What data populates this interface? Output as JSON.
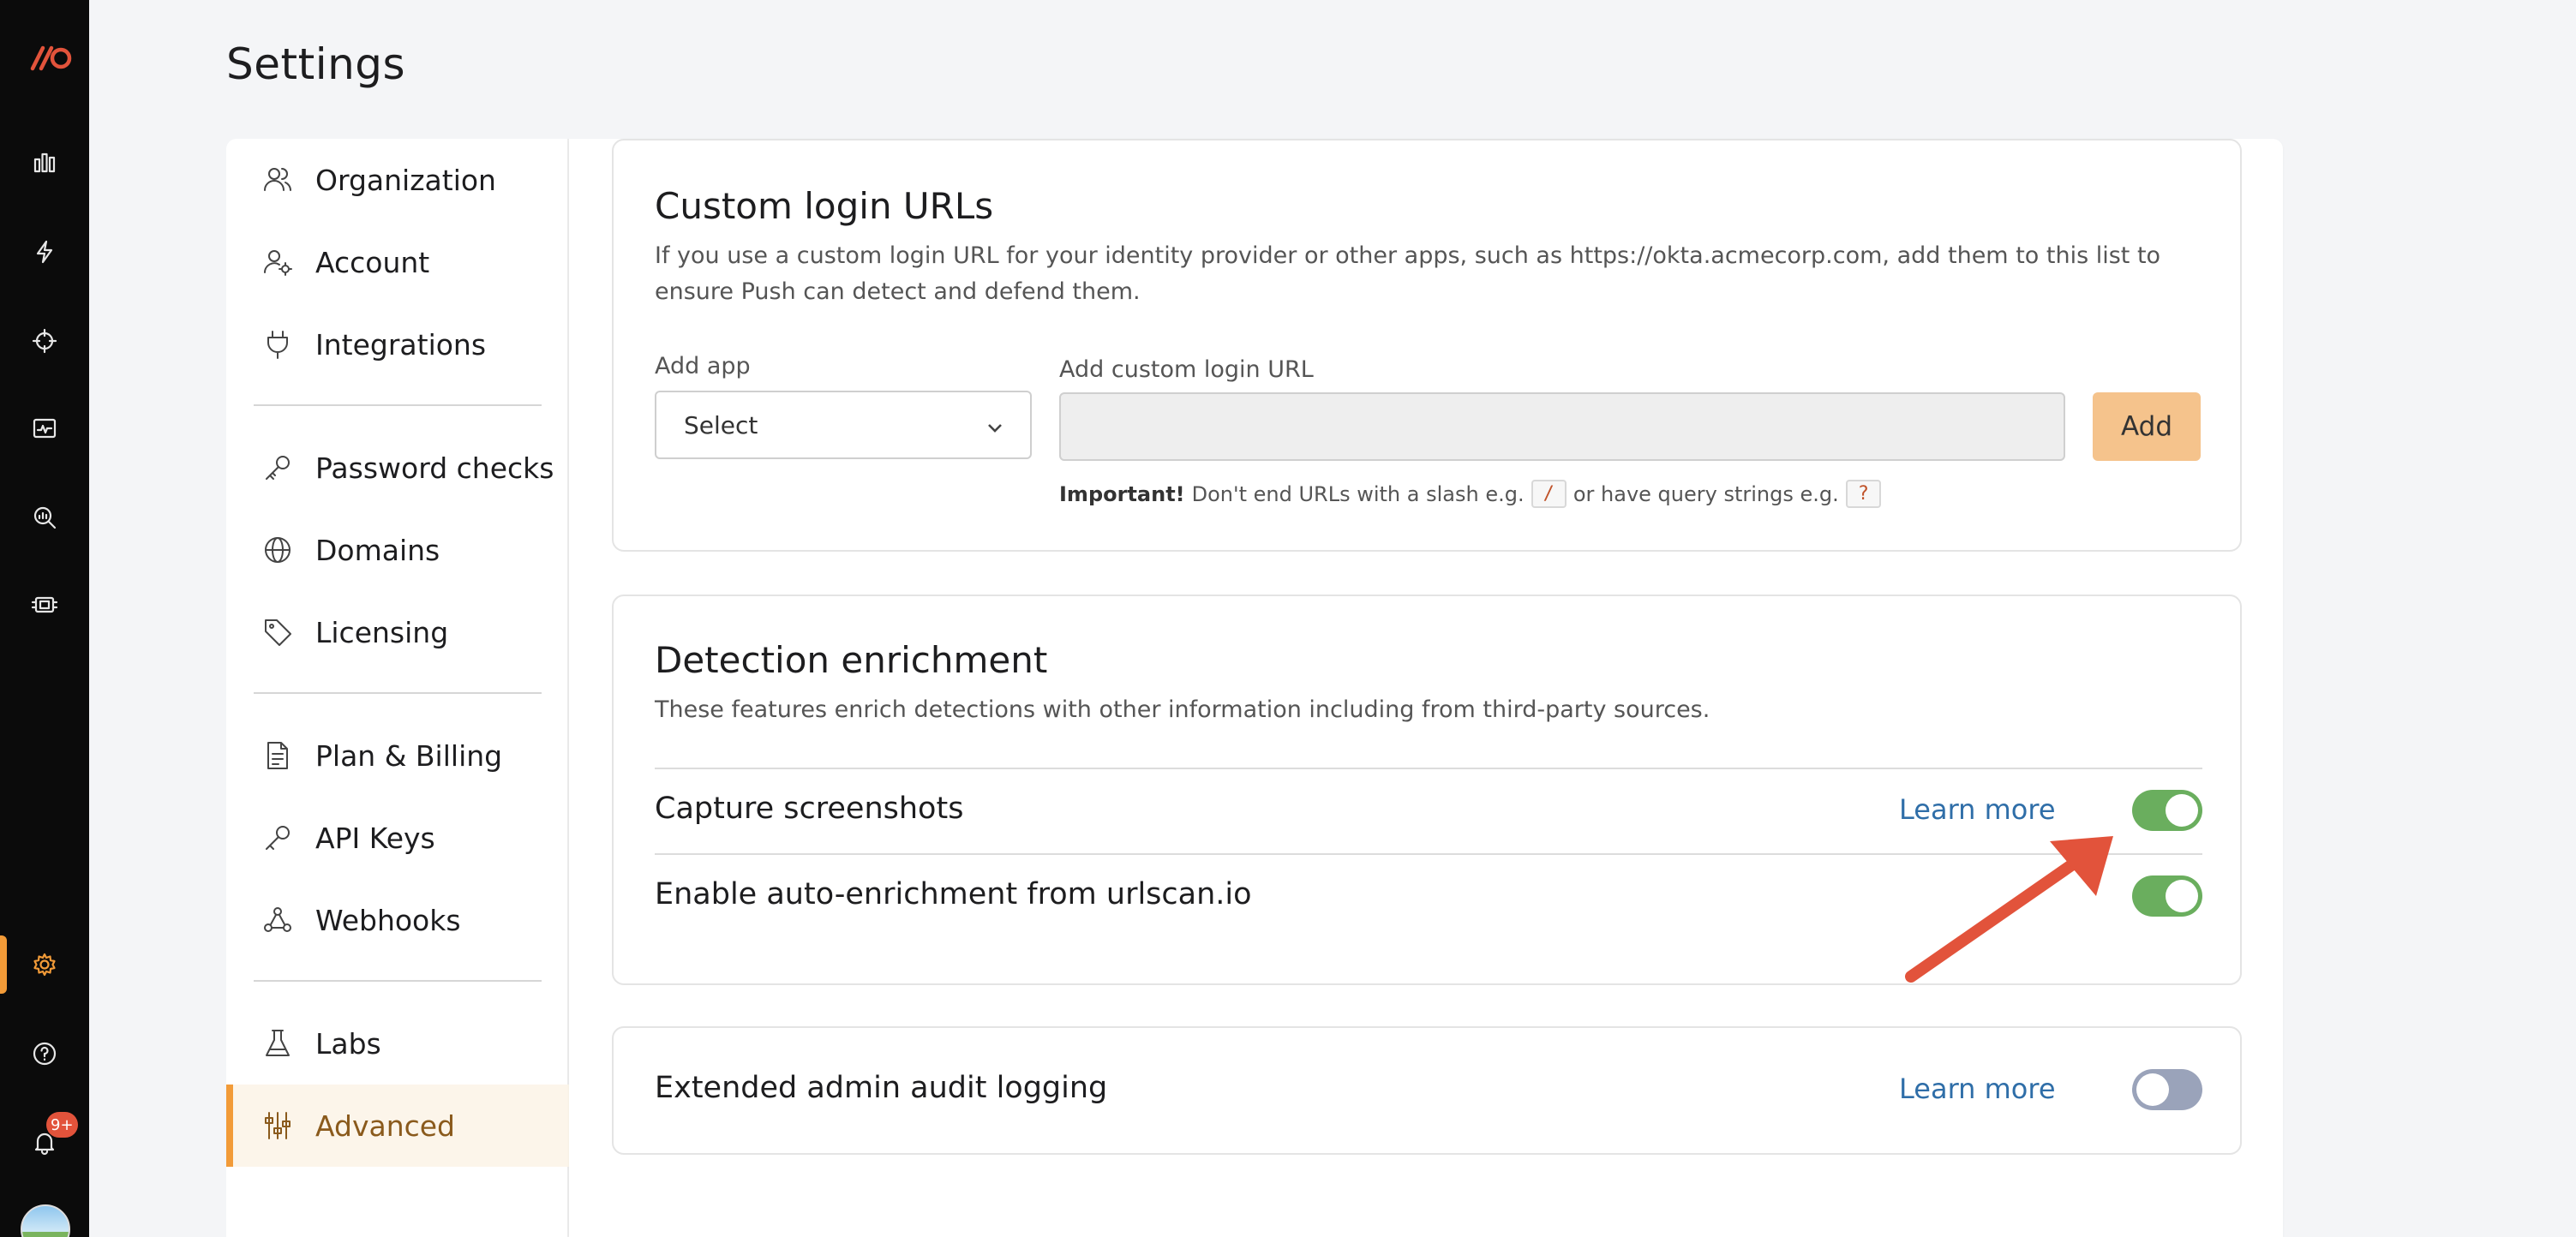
{
  "page": {
    "title": "Settings"
  },
  "rail": {
    "icons": [
      "logo-icon",
      "dashboard-icon",
      "activity-icon",
      "detections-icon",
      "monitor-icon",
      "investigate-icon",
      "integrations-icon",
      "settings-icon",
      "help-icon",
      "notifications-icon"
    ],
    "notification_badge": "9+"
  },
  "nav": {
    "items": [
      {
        "label": "Organization",
        "icon": "users-icon"
      },
      {
        "label": "Account",
        "icon": "user-gear-icon"
      },
      {
        "label": "Integrations",
        "icon": "plug-icon"
      },
      {
        "label": "Password checks",
        "icon": "key-icon"
      },
      {
        "label": "Domains",
        "icon": "globe-icon"
      },
      {
        "label": "Licensing",
        "icon": "tag-icon"
      },
      {
        "label": "Plan & Billing",
        "icon": "document-icon"
      },
      {
        "label": "API Keys",
        "icon": "key-icon"
      },
      {
        "label": "Webhooks",
        "icon": "webhook-icon"
      },
      {
        "label": "Labs",
        "icon": "flask-icon"
      },
      {
        "label": "Advanced",
        "icon": "sliders-icon",
        "active": true
      }
    ]
  },
  "custom_login": {
    "title": "Custom login URLs",
    "description": "If you use a custom login URL for your identity provider or other apps, such as https://okta.acmecorp.com, add them to this list to ensure Push can detect and defend them.",
    "add_app_label": "Add app",
    "select_value": "Select",
    "url_label": "Add custom login URL",
    "url_value": "",
    "add_button": "Add",
    "note_bold": "Important!",
    "note_text_1": "Don't end URLs with a slash e.g.",
    "note_code_1": "/",
    "note_text_2": "or have query strings e.g.",
    "note_code_2": "?"
  },
  "detection": {
    "title": "Detection enrichment",
    "description": "These features enrich detections with other information including from third-party sources.",
    "rows": [
      {
        "label": "Capture screenshots",
        "learn_more": "Learn more",
        "enabled": true
      },
      {
        "label": "Enable auto-enrichment from urlscan.io",
        "enabled": true
      }
    ]
  },
  "audit": {
    "label": "Extended admin audit logging",
    "learn_more": "Learn more",
    "enabled": false
  },
  "colors": {
    "accent": "#f29b38",
    "toggle_on": "#6aae5e",
    "toggle_off": "#9aa3ba",
    "link": "#2f6ea8",
    "annotation_arrow": "#e2533b"
  }
}
